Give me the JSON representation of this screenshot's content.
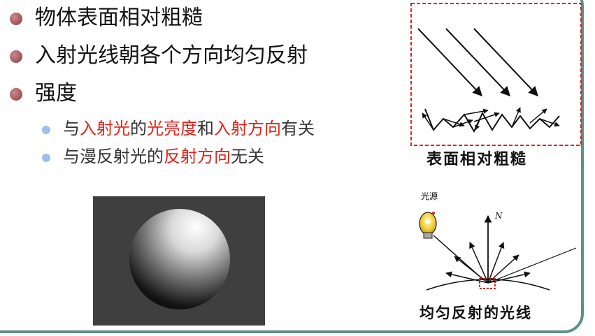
{
  "bullets": [
    {
      "text": "物体表面相对粗糙"
    },
    {
      "text": "入射光线朝各个方向均匀反射"
    },
    {
      "text": "强度"
    }
  ],
  "sub_bullets": [
    {
      "segments": [
        {
          "text": "与",
          "color": "#333333"
        },
        {
          "text": "入射光",
          "color": "#e2231a"
        },
        {
          "text": "的",
          "color": "#333333"
        },
        {
          "text": "光亮度",
          "color": "#e2231a"
        },
        {
          "text": "和",
          "color": "#333333"
        },
        {
          "text": "入射方向",
          "color": "#e2231a"
        },
        {
          "text": "有关",
          "color": "#333333"
        }
      ]
    },
    {
      "segments": [
        {
          "text": "与漫反射光的",
          "color": "#333333"
        },
        {
          "text": "反射方向",
          "color": "#e2231a"
        },
        {
          "text": "无关",
          "color": "#333333"
        }
      ]
    }
  ],
  "figure_rough": {
    "caption": "表面相对粗糙"
  },
  "figure_light": {
    "light_label": "光源",
    "normal_label": "N",
    "caption": "均匀反射的光线"
  },
  "colors": {
    "frame": "#5e8f89",
    "accent_red": "#e2231a",
    "bullet": "#a45b60",
    "sub_bullet": "#9cc0e8"
  }
}
